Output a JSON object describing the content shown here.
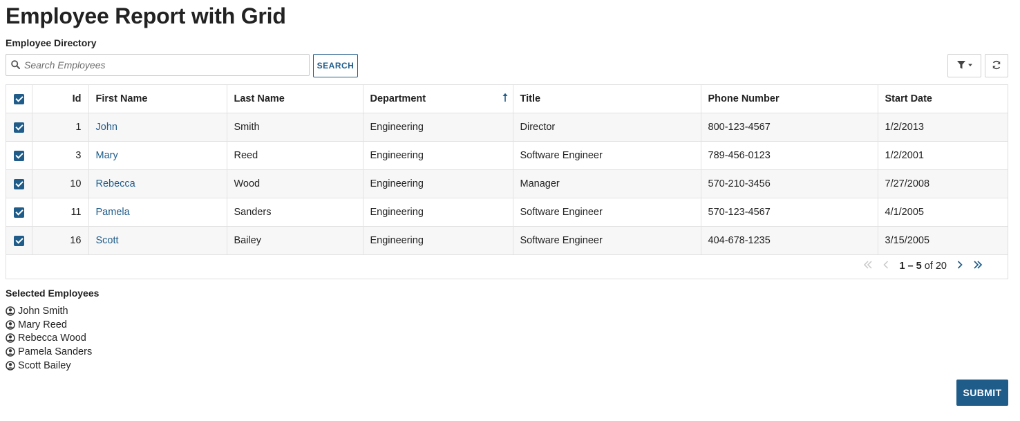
{
  "page": {
    "title": "Employee Report with Grid"
  },
  "directory": {
    "label": "Employee Directory",
    "search": {
      "placeholder": "Search Employees",
      "value": "",
      "button_label": "SEARCH"
    }
  },
  "toolbar": {
    "filter_icon": "filter-icon",
    "refresh_icon": "refresh-icon"
  },
  "grid": {
    "columns": [
      "Id",
      "First Name",
      "Last Name",
      "Department",
      "Title",
      "Phone Number",
      "Start Date"
    ],
    "sorted_column": "Department",
    "sort_direction": "ascending",
    "rows": [
      {
        "selected": true,
        "id": "1",
        "first_name": "John",
        "last_name": "Smith",
        "department": "Engineering",
        "title": "Director",
        "phone": "800-123-4567",
        "start_date": "1/2/2013"
      },
      {
        "selected": true,
        "id": "3",
        "first_name": "Mary",
        "last_name": "Reed",
        "department": "Engineering",
        "title": "Software Engineer",
        "phone": "789-456-0123",
        "start_date": "1/2/2001"
      },
      {
        "selected": true,
        "id": "10",
        "first_name": "Rebecca",
        "last_name": "Wood",
        "department": "Engineering",
        "title": "Manager",
        "phone": "570-210-3456",
        "start_date": "7/27/2008"
      },
      {
        "selected": true,
        "id": "11",
        "first_name": "Pamela",
        "last_name": "Sanders",
        "department": "Engineering",
        "title": "Software Engineer",
        "phone": "570-123-4567",
        "start_date": "4/1/2005"
      },
      {
        "selected": true,
        "id": "16",
        "first_name": "Scott",
        "last_name": "Bailey",
        "department": "Engineering",
        "title": "Software Engineer",
        "phone": "404-678-1235",
        "start_date": "3/15/2005"
      }
    ],
    "pagination": {
      "range": "1 – 5",
      "of_label": "of",
      "total": "20"
    }
  },
  "selected": {
    "label": "Selected Employees",
    "employees": [
      "John Smith",
      "Mary Reed",
      "Rebecca Wood",
      "Pamela Sanders",
      "Scott Bailey"
    ]
  },
  "submit": {
    "label": "SUBMIT"
  },
  "colors": {
    "accent": "#1f5c8a",
    "row_alt": "#f7f7f7",
    "border": "#e2e2e2"
  }
}
